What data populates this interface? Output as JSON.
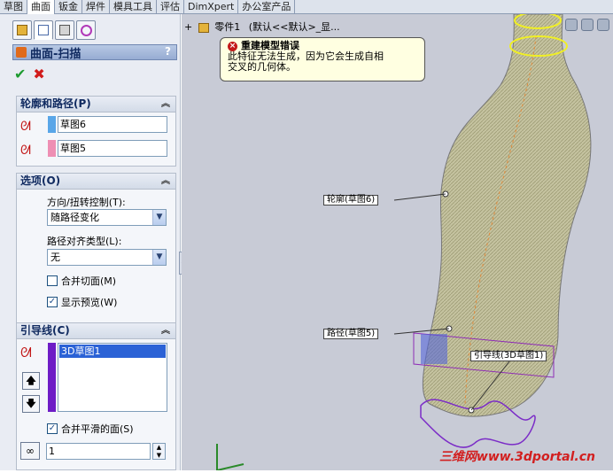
{
  "tabs": [
    "草图",
    "曲面",
    "钣金",
    "焊件",
    "模具工具",
    "评估",
    "DimXpert",
    "办公室产品"
  ],
  "active_tab": 1,
  "feature": {
    "title": "曲面-扫描",
    "help": "?"
  },
  "sections": {
    "profile_path": {
      "title": "轮廓和路径(P)",
      "profile": "草图6",
      "path": "草图5"
    },
    "options": {
      "title": "选项(O)",
      "orientation_label": "方向/扭转控制(T):",
      "orientation_value": "随路径变化",
      "align_label": "路径对齐类型(L):",
      "align_value": "无",
      "merge_tangent": "合并切面(M)",
      "show_preview": "显示预览(W)"
    },
    "guides": {
      "title": "引导线(C)",
      "item": "3D草图1",
      "merge_smooth": "合并平滑的面(S)",
      "count": "1"
    }
  },
  "tree": {
    "root": "零件1",
    "config": "(默认<<默认>_显..."
  },
  "error": {
    "title": "重建模型错误",
    "line1": "此特征无法生成，因为它会生成自相",
    "line2": "交叉的几何体。"
  },
  "callouts": {
    "profile": "轮廓(草图6)",
    "path": "路径(草图5)",
    "guide": "引导线(3D草图1)"
  },
  "watermark": "三维网www.3dportal.cn",
  "colors": {
    "profile_swatch": "#59a6e8",
    "path_swatch": "#ee8fb4",
    "guide_swatch": "#6e1cc6",
    "selected": "#2b62d6",
    "body": "#c5c3a0"
  }
}
